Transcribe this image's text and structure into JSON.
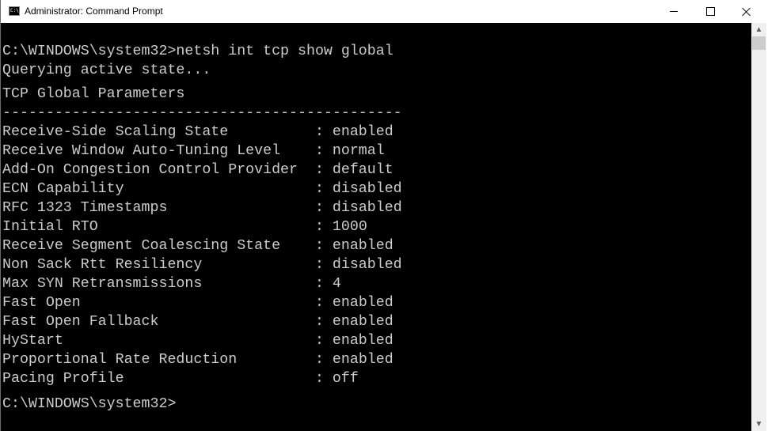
{
  "window": {
    "title": "Administrator: Command Prompt",
    "icon": "cmd-icon",
    "icon_text": "C:\\_",
    "controls": {
      "minimize": "minimize-icon",
      "maximize": "maximize-icon",
      "close": "close-icon"
    }
  },
  "console": {
    "command_line": "C:\\WINDOWS\\system32>netsh int tcp show global",
    "status": "Querying active state...",
    "heading": "TCP Global Parameters",
    "separator": "----------------------------------------------",
    "parameters": [
      {
        "name": "Receive-Side Scaling State",
        "value": "enabled"
      },
      {
        "name": "Receive Window Auto-Tuning Level",
        "value": "normal"
      },
      {
        "name": "Add-On Congestion Control Provider",
        "value": "default"
      },
      {
        "name": "ECN Capability",
        "value": "disabled"
      },
      {
        "name": "RFC 1323 Timestamps",
        "value": "disabled"
      },
      {
        "name": "Initial RTO",
        "value": "1000"
      },
      {
        "name": "Receive Segment Coalescing State",
        "value": "enabled"
      },
      {
        "name": "Non Sack Rtt Resiliency",
        "value": "disabled"
      },
      {
        "name": "Max SYN Retransmissions",
        "value": "4"
      },
      {
        "name": "Fast Open",
        "value": "enabled"
      },
      {
        "name": "Fast Open Fallback",
        "value": "enabled"
      },
      {
        "name": "HyStart",
        "value": "enabled"
      },
      {
        "name": "Proportional Rate Reduction",
        "value": "enabled"
      },
      {
        "name": "Pacing Profile",
        "value": "off"
      }
    ],
    "prompt": "C:\\WINDOWS\\system32>"
  },
  "colors": {
    "console_bg": "#000000",
    "console_fg": "#cccccc",
    "titlebar_bg": "#ffffff",
    "scrollbar_bg": "#f0f0f0",
    "scrollbar_thumb": "#cdcdcd"
  }
}
